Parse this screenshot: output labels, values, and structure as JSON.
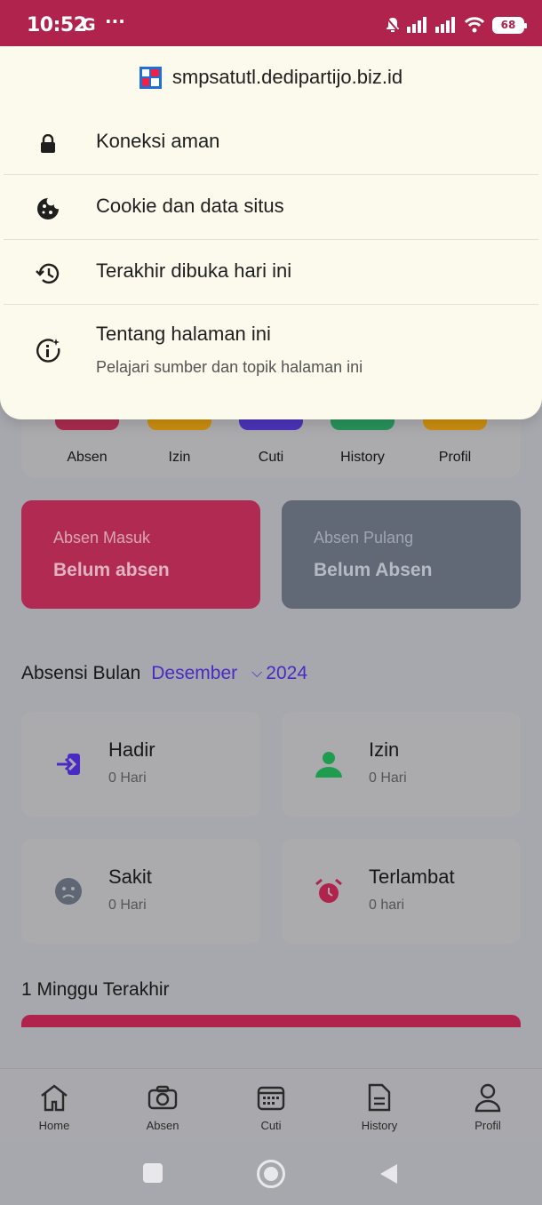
{
  "status": {
    "time": "10:52",
    "g": "G",
    "dots": "···",
    "battery": "68"
  },
  "popup": {
    "url": "smpsatutl.dedipartijo.biz.id",
    "items": [
      {
        "label": "Koneksi aman",
        "icon": "lock-icon"
      },
      {
        "label": "Cookie dan data situs",
        "icon": "cookie-icon"
      },
      {
        "label": "Terakhir dibuka hari ini",
        "icon": "history-icon"
      },
      {
        "label": "Tentang halaman ini",
        "sub": "Pelajari sumber dan topik halaman ini",
        "icon": "info-sparkle-icon"
      }
    ]
  },
  "menu": [
    {
      "label": "Absen",
      "color": "#b0234c",
      "icon": "camera-icon"
    },
    {
      "label": "Izin",
      "color": "#d39400",
      "icon": "copy-icon"
    },
    {
      "label": "Cuti",
      "color": "#4a2ac4",
      "icon": "calendar-icon"
    },
    {
      "label": "History",
      "color": "#1f9c4e",
      "icon": "document-icon"
    },
    {
      "label": "Profil",
      "color": "#d39400",
      "icon": "user-icon"
    }
  ],
  "attendance": {
    "masuk": {
      "label": "Absen Masuk",
      "value": "Belum absen",
      "color": "#b0234c"
    },
    "pulang": {
      "label": "Absen Pulang",
      "value": "Belum Absen",
      "color": "#5f6775"
    }
  },
  "month": {
    "title": "Absensi Bulan",
    "month": "Desember",
    "year": "2024"
  },
  "stats": [
    {
      "title": "Hadir",
      "sub": "0 Hari",
      "icon": "login-icon",
      "color": "#4a2ac4"
    },
    {
      "title": "Izin",
      "sub": "0 Hari",
      "icon": "person-icon",
      "color": "#1f9c4e"
    },
    {
      "title": "Sakit",
      "sub": "0 Hari",
      "icon": "sad-face-icon",
      "color": "#5f6775"
    },
    {
      "title": "Terlambat",
      "sub": "0 hari",
      "icon": "alarm-icon",
      "color": "#b0234c"
    }
  ],
  "week": {
    "title": "1 Minggu Terakhir"
  },
  "nav": [
    {
      "label": "Home",
      "icon": "home-icon"
    },
    {
      "label": "Absen",
      "icon": "camera-icon"
    },
    {
      "label": "Cuti",
      "icon": "calendar-icon"
    },
    {
      "label": "History",
      "icon": "document-icon"
    },
    {
      "label": "Profil",
      "icon": "user-icon"
    }
  ]
}
